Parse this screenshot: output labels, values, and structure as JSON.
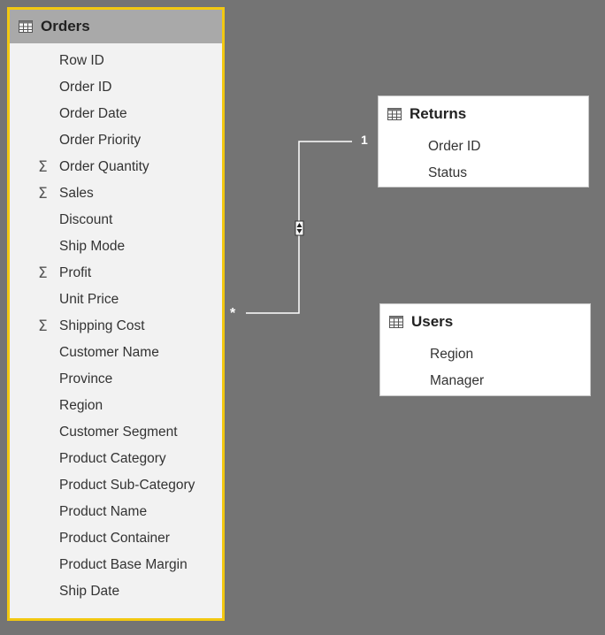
{
  "tables": {
    "orders": {
      "name": "Orders",
      "fields": [
        {
          "label": "Row ID",
          "measure": false
        },
        {
          "label": "Order ID",
          "measure": false
        },
        {
          "label": "Order Date",
          "measure": false
        },
        {
          "label": "Order Priority",
          "measure": false
        },
        {
          "label": "Order Quantity",
          "measure": true
        },
        {
          "label": "Sales",
          "measure": true
        },
        {
          "label": "Discount",
          "measure": false
        },
        {
          "label": "Ship Mode",
          "measure": false
        },
        {
          "label": "Profit",
          "measure": true
        },
        {
          "label": "Unit Price",
          "measure": false
        },
        {
          "label": "Shipping Cost",
          "measure": true
        },
        {
          "label": "Customer Name",
          "measure": false
        },
        {
          "label": "Province",
          "measure": false
        },
        {
          "label": "Region",
          "measure": false
        },
        {
          "label": "Customer Segment",
          "measure": false
        },
        {
          "label": "Product Category",
          "measure": false
        },
        {
          "label": "Product Sub-Category",
          "measure": false
        },
        {
          "label": "Product Name",
          "measure": false
        },
        {
          "label": "Product Container",
          "measure": false
        },
        {
          "label": "Product Base Margin",
          "measure": false
        },
        {
          "label": "Ship Date",
          "measure": false
        }
      ]
    },
    "returns": {
      "name": "Returns",
      "fields": [
        {
          "label": "Order ID",
          "measure": false
        },
        {
          "label": "Status",
          "measure": false
        }
      ]
    },
    "users": {
      "name": "Users",
      "fields": [
        {
          "label": "Region",
          "measure": false
        },
        {
          "label": "Manager",
          "measure": false
        }
      ]
    }
  },
  "relationship": {
    "one_side_label": "1",
    "many_side_label": "*",
    "line_color": "#ffffff"
  },
  "colors": {
    "canvas": "#747474",
    "selected_border": "#f2c811",
    "card_background": "#f2f2f2"
  },
  "sigma_symbol": "Σ"
}
